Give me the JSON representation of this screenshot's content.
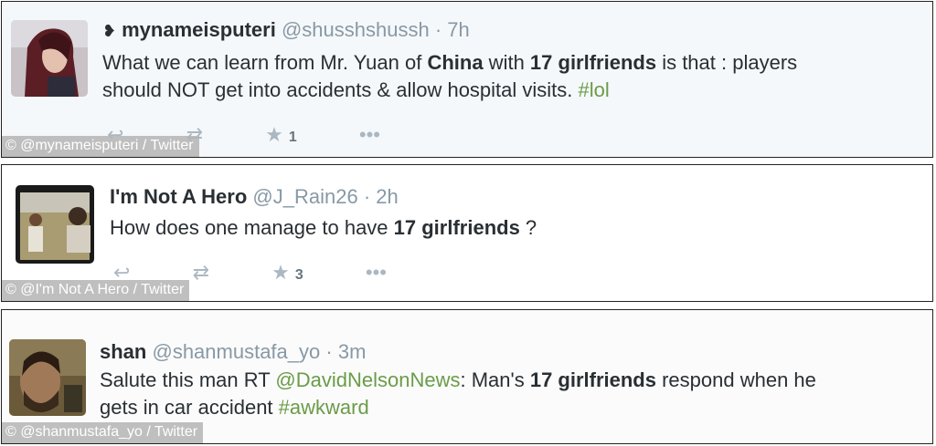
{
  "tweets": [
    {
      "display_name": "mynameisputeri",
      "handle": "@shusshshussh",
      "separator": "·",
      "time": "7h",
      "text": {
        "line1_a": "What we can learn from Mr. Yuan of ",
        "line1_b": "China",
        "line1_c": " with ",
        "line1_d": "17 girlfriends",
        "line1_e": " is that : players",
        "line2_a": "should NOT get into accidents & allow hospital visits. ",
        "line2_tag": "#lol"
      },
      "star_count": "1",
      "credit": "© @mynameisputeri / Twitter"
    },
    {
      "display_name": "I'm Not A Hero",
      "handle": "@J_Rain26",
      "separator": "·",
      "time": "2h",
      "text": {
        "line1_a": "How does one manage to have ",
        "line1_b": "17 girlfriends",
        "line1_c": " ?"
      },
      "star_count": "3",
      "credit": "© @I'm Not A Hero / Twitter"
    },
    {
      "display_name": "shan",
      "handle": "@shanmustafa_yo",
      "separator": "·",
      "time": "3m",
      "text": {
        "line1_a": "Salute this man RT ",
        "line1_mention": "@DavidNelsonNews",
        "line1_b": ": Man's ",
        "line1_c": "17 girlfriends",
        "line1_d": " respond when he",
        "line2_a": "gets in car accident ",
        "line2_tag": "#awkward"
      },
      "credit": "© @shanmustafa_yo / Twitter"
    }
  ],
  "colors": {
    "link_green": "#6a9c48",
    "muted": "#8899a6",
    "icon_gray": "#aab8c2"
  },
  "icons": [
    "reply-icon",
    "retweet-icon",
    "favorite-star-icon",
    "more-dots-icon",
    "conversation-indicator-icon"
  ]
}
